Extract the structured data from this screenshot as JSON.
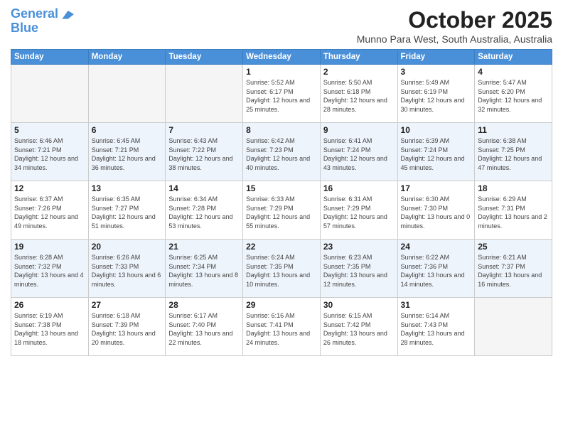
{
  "logo": {
    "line1": "General",
    "line2": "Blue"
  },
  "header": {
    "month": "October 2025",
    "location": "Munno Para West, South Australia, Australia"
  },
  "weekdays": [
    "Sunday",
    "Monday",
    "Tuesday",
    "Wednesday",
    "Thursday",
    "Friday",
    "Saturday"
  ],
  "weeks": [
    [
      {
        "day": "",
        "info": ""
      },
      {
        "day": "",
        "info": ""
      },
      {
        "day": "",
        "info": ""
      },
      {
        "day": "1",
        "info": "Sunrise: 5:52 AM\nSunset: 6:17 PM\nDaylight: 12 hours\nand 25 minutes."
      },
      {
        "day": "2",
        "info": "Sunrise: 5:50 AM\nSunset: 6:18 PM\nDaylight: 12 hours\nand 28 minutes."
      },
      {
        "day": "3",
        "info": "Sunrise: 5:49 AM\nSunset: 6:19 PM\nDaylight: 12 hours\nand 30 minutes."
      },
      {
        "day": "4",
        "info": "Sunrise: 5:47 AM\nSunset: 6:20 PM\nDaylight: 12 hours\nand 32 minutes."
      }
    ],
    [
      {
        "day": "5",
        "info": "Sunrise: 6:46 AM\nSunset: 7:21 PM\nDaylight: 12 hours\nand 34 minutes."
      },
      {
        "day": "6",
        "info": "Sunrise: 6:45 AM\nSunset: 7:21 PM\nDaylight: 12 hours\nand 36 minutes."
      },
      {
        "day": "7",
        "info": "Sunrise: 6:43 AM\nSunset: 7:22 PM\nDaylight: 12 hours\nand 38 minutes."
      },
      {
        "day": "8",
        "info": "Sunrise: 6:42 AM\nSunset: 7:23 PM\nDaylight: 12 hours\nand 40 minutes."
      },
      {
        "day": "9",
        "info": "Sunrise: 6:41 AM\nSunset: 7:24 PM\nDaylight: 12 hours\nand 43 minutes."
      },
      {
        "day": "10",
        "info": "Sunrise: 6:39 AM\nSunset: 7:24 PM\nDaylight: 12 hours\nand 45 minutes."
      },
      {
        "day": "11",
        "info": "Sunrise: 6:38 AM\nSunset: 7:25 PM\nDaylight: 12 hours\nand 47 minutes."
      }
    ],
    [
      {
        "day": "12",
        "info": "Sunrise: 6:37 AM\nSunset: 7:26 PM\nDaylight: 12 hours\nand 49 minutes."
      },
      {
        "day": "13",
        "info": "Sunrise: 6:35 AM\nSunset: 7:27 PM\nDaylight: 12 hours\nand 51 minutes."
      },
      {
        "day": "14",
        "info": "Sunrise: 6:34 AM\nSunset: 7:28 PM\nDaylight: 12 hours\nand 53 minutes."
      },
      {
        "day": "15",
        "info": "Sunrise: 6:33 AM\nSunset: 7:29 PM\nDaylight: 12 hours\nand 55 minutes."
      },
      {
        "day": "16",
        "info": "Sunrise: 6:31 AM\nSunset: 7:29 PM\nDaylight: 12 hours\nand 57 minutes."
      },
      {
        "day": "17",
        "info": "Sunrise: 6:30 AM\nSunset: 7:30 PM\nDaylight: 13 hours\nand 0 minutes."
      },
      {
        "day": "18",
        "info": "Sunrise: 6:29 AM\nSunset: 7:31 PM\nDaylight: 13 hours\nand 2 minutes."
      }
    ],
    [
      {
        "day": "19",
        "info": "Sunrise: 6:28 AM\nSunset: 7:32 PM\nDaylight: 13 hours\nand 4 minutes."
      },
      {
        "day": "20",
        "info": "Sunrise: 6:26 AM\nSunset: 7:33 PM\nDaylight: 13 hours\nand 6 minutes."
      },
      {
        "day": "21",
        "info": "Sunrise: 6:25 AM\nSunset: 7:34 PM\nDaylight: 13 hours\nand 8 minutes."
      },
      {
        "day": "22",
        "info": "Sunrise: 6:24 AM\nSunset: 7:35 PM\nDaylight: 13 hours\nand 10 minutes."
      },
      {
        "day": "23",
        "info": "Sunrise: 6:23 AM\nSunset: 7:35 PM\nDaylight: 13 hours\nand 12 minutes."
      },
      {
        "day": "24",
        "info": "Sunrise: 6:22 AM\nSunset: 7:36 PM\nDaylight: 13 hours\nand 14 minutes."
      },
      {
        "day": "25",
        "info": "Sunrise: 6:21 AM\nSunset: 7:37 PM\nDaylight: 13 hours\nand 16 minutes."
      }
    ],
    [
      {
        "day": "26",
        "info": "Sunrise: 6:19 AM\nSunset: 7:38 PM\nDaylight: 13 hours\nand 18 minutes."
      },
      {
        "day": "27",
        "info": "Sunrise: 6:18 AM\nSunset: 7:39 PM\nDaylight: 13 hours\nand 20 minutes."
      },
      {
        "day": "28",
        "info": "Sunrise: 6:17 AM\nSunset: 7:40 PM\nDaylight: 13 hours\nand 22 minutes."
      },
      {
        "day": "29",
        "info": "Sunrise: 6:16 AM\nSunset: 7:41 PM\nDaylight: 13 hours\nand 24 minutes."
      },
      {
        "day": "30",
        "info": "Sunrise: 6:15 AM\nSunset: 7:42 PM\nDaylight: 13 hours\nand 26 minutes."
      },
      {
        "day": "31",
        "info": "Sunrise: 6:14 AM\nSunset: 7:43 PM\nDaylight: 13 hours\nand 28 minutes."
      },
      {
        "day": "",
        "info": ""
      }
    ]
  ]
}
